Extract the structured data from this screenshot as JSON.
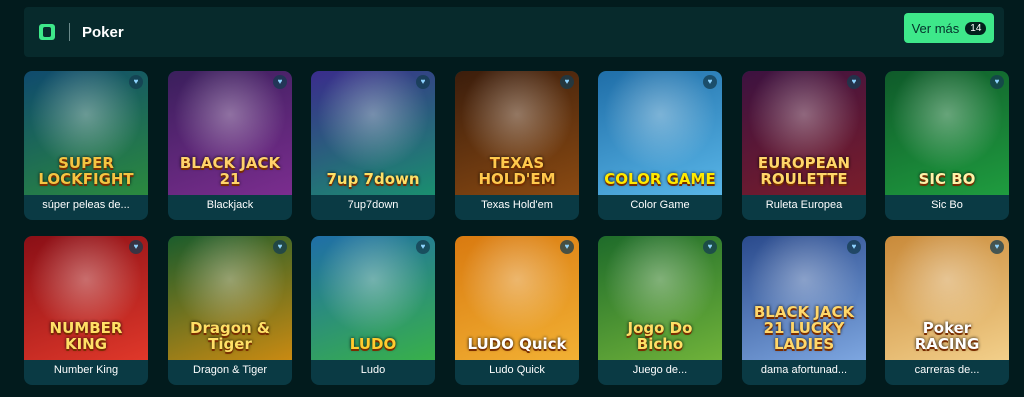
{
  "section": {
    "title": "Poker",
    "more_label": "Ver más",
    "more_count": "14"
  },
  "games": [
    {
      "label": "súper peleas de...",
      "art": "SUPER LOCKFIGHT",
      "bg1": "#0f4a6e",
      "bg2": "#2b8a3e",
      "accent": "#f4c542"
    },
    {
      "label": "Blackjack",
      "art": "BLACK JACK 21",
      "bg1": "#3a1f5c",
      "bg2": "#7b2d8f",
      "accent": "#ffd36b"
    },
    {
      "label": "7up7down",
      "art": "7up 7down",
      "bg1": "#3a2c8c",
      "bg2": "#1a8f6f",
      "accent": "#ffe066"
    },
    {
      "label": "Texas Hold'em",
      "art": "TEXAS HOLD'EM",
      "bg1": "#3b1d0c",
      "bg2": "#8a4a12",
      "accent": "#ffc94d"
    },
    {
      "label": "Color Game",
      "art": "COLOR GAME",
      "bg1": "#1f6ea8",
      "bg2": "#59b6e8",
      "accent": "#ffea00"
    },
    {
      "label": "Ruleta Europea",
      "art": "EUROPEAN ROULETTE",
      "bg1": "#3c1240",
      "bg2": "#7a1d2b",
      "accent": "#ffd76a"
    },
    {
      "label": "Sic Bo",
      "art": "SIC BO",
      "bg1": "#0f5a2a",
      "bg2": "#1f9c3f",
      "accent": "#fff2a8"
    },
    {
      "label": "Number King",
      "art": "NUMBER KING",
      "bg1": "#8a0f16",
      "bg2": "#e0382a",
      "accent": "#ffe066"
    },
    {
      "label": "Dragon & Tiger",
      "art": "Dragon & Tiger",
      "bg1": "#1a5c2c",
      "bg2": "#c98a12",
      "accent": "#ffe066"
    },
    {
      "label": "Ludo",
      "art": "LUDO",
      "bg1": "#1f6ea8",
      "bg2": "#38b04a",
      "accent": "#ffcc2e"
    },
    {
      "label": "Ludo Quick",
      "art": "LUDO Quick",
      "bg1": "#d97a10",
      "bg2": "#f2b134",
      "accent": "#ffffff"
    },
    {
      "label": "Juego de...",
      "art": "Jogo Do Bicho",
      "bg1": "#1e6b2a",
      "bg2": "#6fb23a",
      "accent": "#ffe066"
    },
    {
      "label": "dama afortunad...",
      "art": "BLACK JACK 21 LUCKY LADIES",
      "bg1": "#2a4a8c",
      "bg2": "#7da6e0",
      "accent": "#ffd76a"
    },
    {
      "label": "carreras de...",
      "art": "Poker RACING",
      "bg1": "#c98a3a",
      "bg2": "#f2cf8a",
      "accent": "#ffffff"
    }
  ]
}
